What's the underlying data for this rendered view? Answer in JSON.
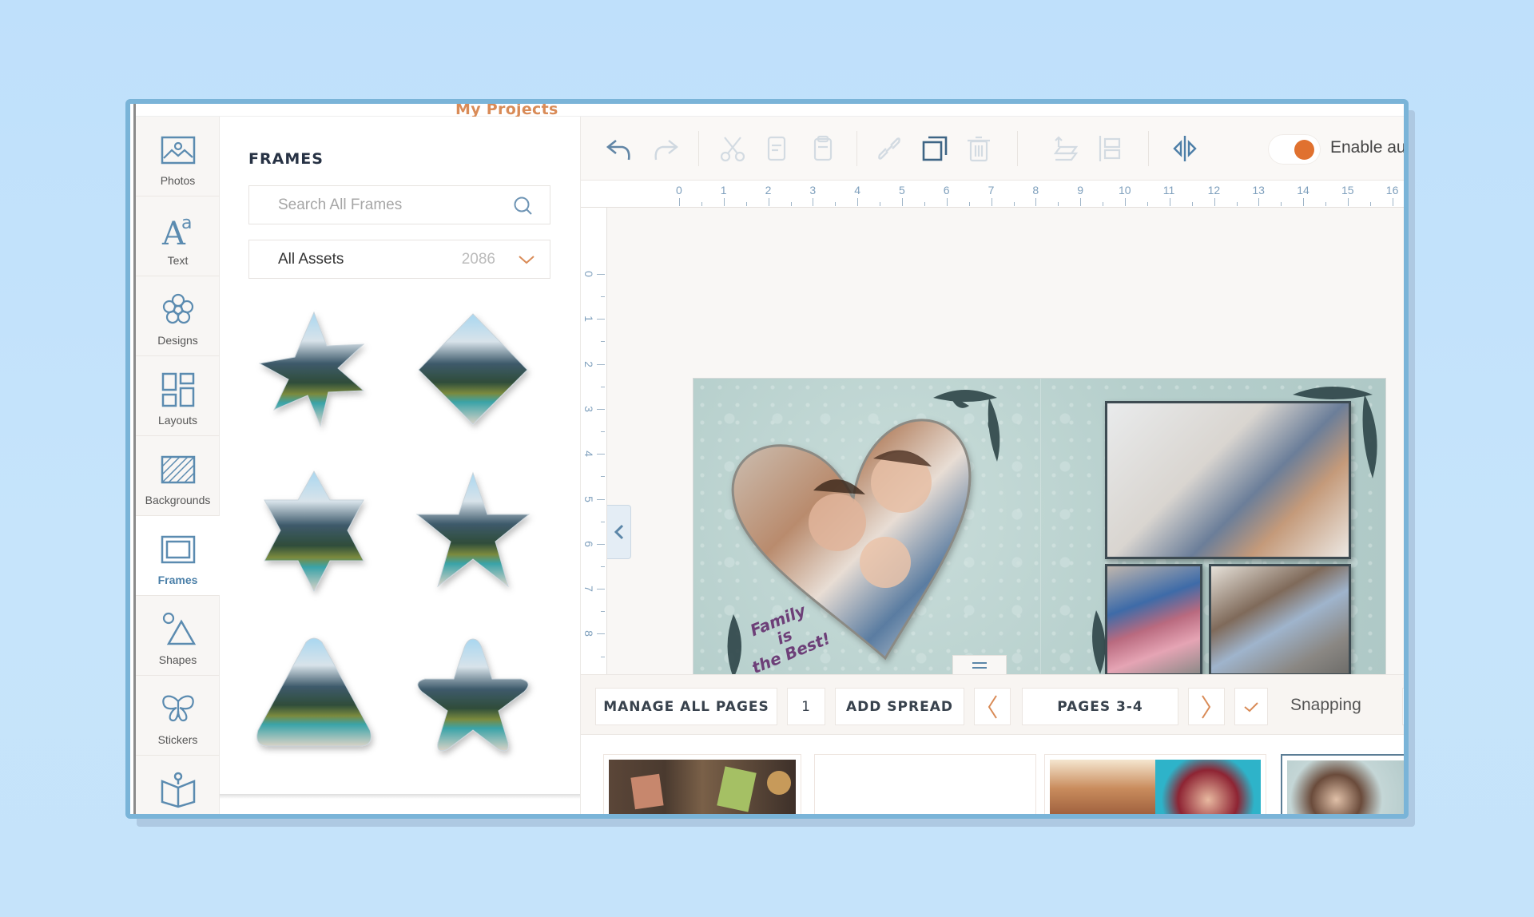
{
  "app": {
    "top_link": "My Projects",
    "accent_color": "#d98b57",
    "toggle_color": "#e0712f",
    "icon_color": "#5b8bb0"
  },
  "sidebar": {
    "items": [
      {
        "label": "Photos",
        "icon": "photo-icon",
        "active": false
      },
      {
        "label": "Text",
        "icon": "text-icon",
        "active": false
      },
      {
        "label": "Designs",
        "icon": "flower-icon",
        "active": false
      },
      {
        "label": "Layouts",
        "icon": "layout-grid-icon",
        "active": false
      },
      {
        "label": "Backgrounds",
        "icon": "background-pattern-icon",
        "active": false
      },
      {
        "label": "Frames",
        "icon": "frame-icon",
        "active": true
      },
      {
        "label": "Shapes",
        "icon": "shapes-icon",
        "active": false
      },
      {
        "label": "Stickers",
        "icon": "butterfly-icon",
        "active": false
      },
      {
        "label": "",
        "icon": "open-book-icon",
        "active": false
      }
    ]
  },
  "panel": {
    "title": "FRAMES",
    "search_placeholder": "Search All Frames",
    "filter": {
      "selected": "All Assets",
      "count": "2086"
    },
    "frames": [
      {
        "shape": "eight-point-burst"
      },
      {
        "shape": "diamond"
      },
      {
        "shape": "six-point-star"
      },
      {
        "shape": "five-point-star"
      },
      {
        "shape": "rounded-triangle"
      },
      {
        "shape": "rounded-five-point-star"
      }
    ]
  },
  "toolbar": {
    "buttons": [
      {
        "name": "undo",
        "enabled": true
      },
      {
        "name": "redo",
        "enabled": false
      },
      {
        "name": "cut",
        "enabled": false
      },
      {
        "name": "copy",
        "enabled": false
      },
      {
        "name": "paste",
        "enabled": false
      },
      {
        "name": "link",
        "enabled": false
      },
      {
        "name": "duplicate",
        "enabled": true
      },
      {
        "name": "delete",
        "enabled": false
      },
      {
        "name": "arrange",
        "enabled": false
      },
      {
        "name": "align",
        "enabled": false
      },
      {
        "name": "flip-horizontal",
        "enabled": true
      }
    ],
    "toggle": {
      "label": "Enable aut",
      "on": true
    }
  },
  "rulers": {
    "horizontal": [
      "0",
      "1",
      "2",
      "3",
      "4",
      "5",
      "6",
      "7",
      "8",
      "9",
      "10",
      "11",
      "12",
      "13",
      "14",
      "15",
      "16"
    ],
    "vertical": [
      "0",
      "1",
      "2",
      "3",
      "4",
      "5",
      "6",
      "7",
      "8"
    ]
  },
  "spread": {
    "caption_lines": [
      "Family",
      "is",
      "the Best!"
    ]
  },
  "bottombar": {
    "manage_all_pages": "MANAGE ALL PAGES",
    "page_number": "1",
    "add_spread": "ADD SPREAD",
    "pages_label": "PAGES 3-4",
    "snapping_label": "Snapping",
    "snapping_checked": true,
    "zoom_minus": "—"
  },
  "filmstrip": {
    "thumbs": [
      {
        "name": "spread-cover",
        "selected": false
      },
      {
        "name": "spread-blank",
        "selected": false
      },
      {
        "name": "spread-1-2",
        "selected": false
      },
      {
        "name": "spread-3-4",
        "selected": true
      }
    ]
  }
}
